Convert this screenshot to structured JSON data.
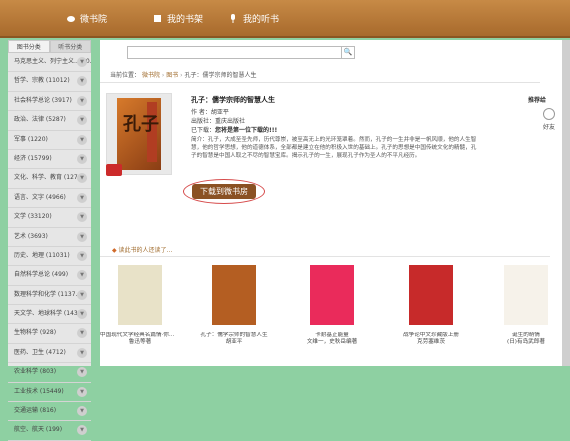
{
  "topnav": {
    "items": [
      {
        "label": "微书院",
        "icon": "cloud-icon"
      },
      {
        "label": "我的书架",
        "icon": "book-icon"
      },
      {
        "label": "我的听书",
        "icon": "microphone-icon"
      }
    ]
  },
  "sidebar": {
    "tabs": [
      "图书分类",
      "听书分类"
    ],
    "items": [
      "马克思主义、列宁主义...(30...",
      "哲学、宗教 (11012)",
      "社会科学总论 (3917)",
      "政治、法律 (5287)",
      "军事 (1220)",
      "经济 (15799)",
      "文化、科学、教育 (1270...",
      "语言、文字 (4966)",
      "文学 (33120)",
      "艺术 (3693)",
      "历史、地理 (11031)",
      "自然科学总论 (499)",
      "数理科学和化学 (1137...",
      "天文学、地球科学 (1435...",
      "生物科学 (928)",
      "医药、卫生 (4712)",
      "农业科学 (803)",
      "工业技术 (15449)",
      "交通运输 (816)",
      "航空、航天 (199)"
    ]
  },
  "search": {
    "placeholder": "",
    "button": "🔍"
  },
  "breadcrumb": {
    "prefix": "当前位置：",
    "home": "微书院",
    "book": "图书",
    "current": "孔子：儒学宗师的智慧人生"
  },
  "book": {
    "cover_title": "孔子",
    "title": "孔子：儒学宗师的智慧人生",
    "author_label": "作 者：",
    "author": "胡亚平",
    "publisher_label": "出版社：",
    "publisher": "重庆出版社",
    "downloads_label": "已下载：",
    "downloads": "您将是第一位下载的!!!",
    "intro_label": "简介：",
    "intro": "孔子，大成至圣先师，历代尊崇，被至高无上的光环笼罩着。然而，孔子的一生并非是一帆风顺，他的人生智慧，他的哲学思想，他的道德体系，全部都是建立在他的积极入世的基础上。孔子的思想是中国传统文化的精髓，孔子的智慧是中国人取之不尽的智慧宝库。揭示孔子的一生，展现孔子作为圣人的不平凡经历。",
    "download_button": "下载到微书房"
  },
  "recommend": {
    "label": "推荐给",
    "friend": "好友"
  },
  "also_read": {
    "heading": "读此书的人还读了...",
    "items": [
      {
        "title": "中国现代文学经典名篇情·你是人间四月天",
        "author": "鲁迅等著"
      },
      {
        "title": "孔子：儒学宗师的智慧人生",
        "author": "胡亚平"
      },
      {
        "title": "卡耐基正能量",
        "author": "文维一，史秋岳编著"
      },
      {
        "title": "战争论中文珍藏版上册",
        "author": "克劳塞维茨"
      },
      {
        "title": "诞生的萌情",
        "author": "(日)有岛武郎著"
      }
    ]
  }
}
